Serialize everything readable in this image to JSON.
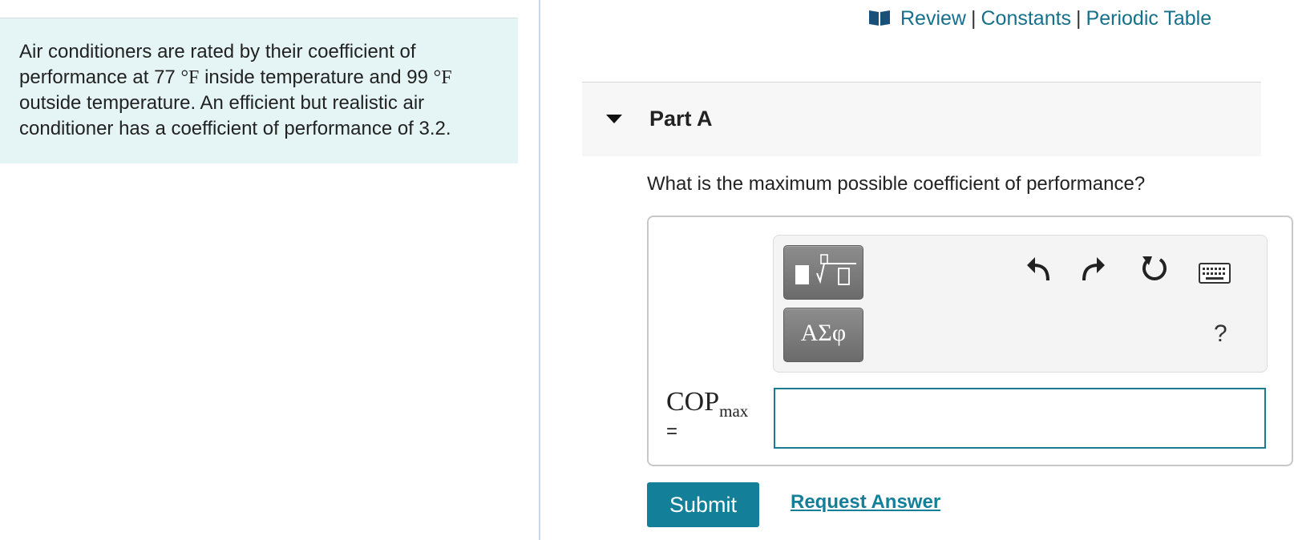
{
  "problem": {
    "seg1": "Air conditioners are rated by their coefficient of performance at 77 ",
    "unit1": "°F",
    "seg2": " inside temperature and 99 ",
    "unit2": "°F",
    "seg3": " outside temperature. An efficient but realistic air conditioner has a coefficient of performance of 3.2."
  },
  "top_links": {
    "review": "Review",
    "constants": "Constants",
    "periodic_table": "Periodic Table",
    "separator": "|"
  },
  "part": {
    "title": "Part A",
    "question": "What is the maximum possible coefficient of performance?"
  },
  "toolbar": {
    "greek_label": "ΑΣφ",
    "help_label": "?"
  },
  "answer": {
    "variable": "COP",
    "subscript": "max",
    "equals": "=",
    "value": ""
  },
  "actions": {
    "submit": "Submit",
    "request_answer": "Request Answer"
  },
  "colors": {
    "accent": "#137f99",
    "link": "#15708c",
    "problem_bg": "#e5f5f6"
  }
}
